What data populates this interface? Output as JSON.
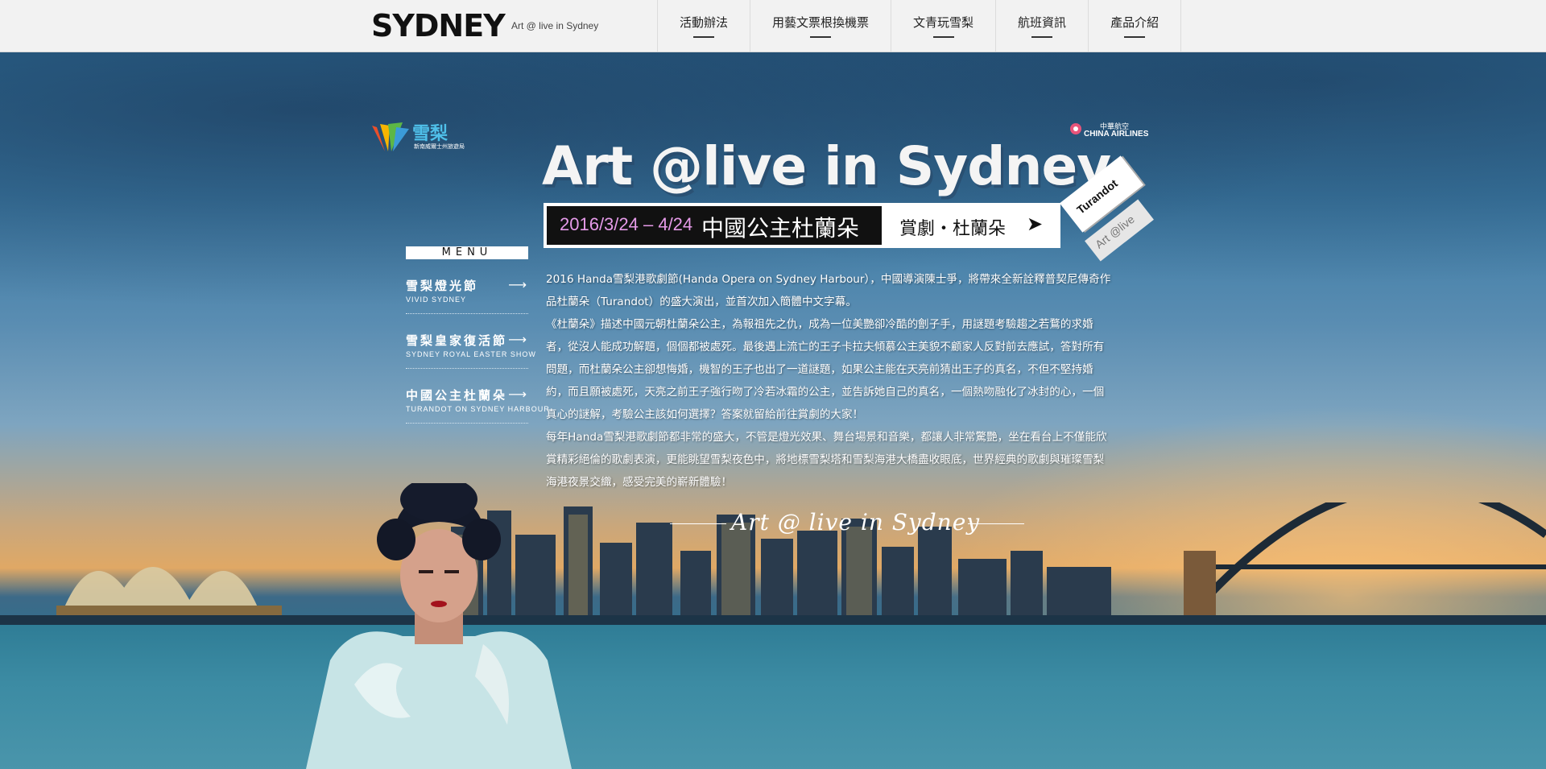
{
  "header": {
    "logo": "SYDNEY",
    "tagline": "Art @ live in Sydney",
    "nav": [
      {
        "label": "活動辦法"
      },
      {
        "label": "用藝文票根換機票"
      },
      {
        "label": "文青玩雪梨"
      },
      {
        "label": "航班資訊"
      },
      {
        "label": "產品介紹"
      }
    ]
  },
  "sponsors": {
    "destination_nsw": {
      "name": "雪梨",
      "sub": "新南威爾士州旅遊局"
    },
    "china_airlines": {
      "cn": "中華航空",
      "en": "CHINA AIRLINES"
    }
  },
  "hero": {
    "title": "Art @live in Sydney",
    "banner": {
      "date": "2016/3/24 – 4/24",
      "show": "中國公主杜蘭朵",
      "cta": "賞劇・杜蘭朵",
      "arrow": "➤"
    },
    "tags": [
      "Turandot",
      "Art @live"
    ],
    "script_title": "Art @ live in Sydney"
  },
  "menu": {
    "heading": "MENU",
    "items": [
      {
        "zh": "雪梨燈光節",
        "en": "VIVID SYDNEY",
        "arrow": "⟶"
      },
      {
        "zh": "雪梨皇家復活節",
        "en": "SYDNEY ROYAL EASTER SHOW",
        "arrow": "⟶"
      },
      {
        "zh": "中國公主杜蘭朵",
        "en": "TURANDOT ON SYDNEY HARBOUR",
        "arrow": "⟶"
      }
    ]
  },
  "description": {
    "p1": "2016 Handa雪梨港歌劇節(Handa Opera on Sydney Harbour），中國導演陳士爭，將帶來全新詮釋普契尼傳奇作品杜蘭朵（Turandot）的盛大演出，並首次加入簡體中文字幕。",
    "p2": "《杜蘭朵》描述中國元朝杜蘭朵公主，為報祖先之仇，成為一位美艷卻冷酷的劊子手，用謎題考驗趨之若鶩的求婚者，從沒人能成功解題，個個都被處死。最後遇上流亡的王子卡拉夫傾慕公主美貌不顧家人反對前去應試，答對所有問題，而杜蘭朵公主卻想悔婚，機智的王子也出了一道謎題，如果公主能在天亮前猜出王子的真名，不但不堅持婚約，而且願被處死，天亮之前王子強行吻了冷若冰霜的公主，並告訴她自己的真名，一個熱吻融化了冰封的心，一個真心的謎解，考驗公主該如何選擇？答案就留給前往賞劇的大家！",
    "p3": "每年Handa雪梨港歌劇節都非常的盛大，不管是燈光效果、舞台場景和音樂，都讓人非常驚艷，坐在看台上不僅能欣賞精彩絕倫的歌劇表演，更能眺望雪梨夜色中，將地標雪梨塔和雪梨海港大橋盡收眼底，世界經典的歌劇與璀璨雪梨海港夜景交織，感受完美的嶄新體驗！"
  }
}
